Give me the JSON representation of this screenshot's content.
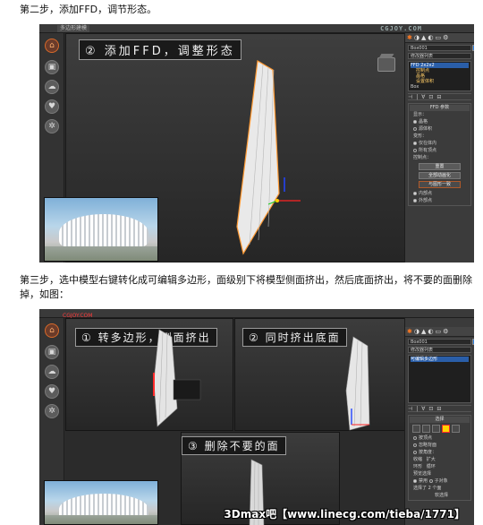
{
  "step2": {
    "text": "第二步，添加FFD，调节形态。"
  },
  "step3": {
    "text": "第三步，选中模型右键转化成可编辑多边形，面级别下将模型侧面挤出，然后底面挤出，将不要的面删除掉，如图："
  },
  "shot1": {
    "tab": "多边形建模",
    "brand": "CGJOY.COM",
    "callout": "② 添加FFD，调整形态",
    "object_name": "Box001",
    "modifier_list": "修改器列表",
    "stack": [
      "FFD 2x2x2",
      "控制点",
      "晶格",
      "设置体积",
      "Box"
    ],
    "rollout_title": "FFD 参数",
    "display_label": "显示：",
    "display_opts": [
      "晶格",
      "源体积"
    ],
    "deform_label": "变形：",
    "deform_opts": [
      "仅在体内",
      "所有顶点"
    ],
    "control_label": "控制点：",
    "buttons": [
      "重置",
      "全部动画化",
      "与图形一致"
    ],
    "checks": [
      "内部点",
      "外部点"
    ]
  },
  "shot2": {
    "tab_red": "CGJOY.COM",
    "callout1": "① 转多边形，侧面挤出",
    "callout2": "② 同时挤出底面",
    "callout3": "③ 删除不要的面",
    "object_name": "Box001",
    "modifier_list": "修改器列表",
    "stack": [
      "可编辑多边形"
    ],
    "rollout_title": "选择",
    "opts": [
      "按顶点",
      "忽略背面",
      "按角度：",
      "收缩",
      "扩大",
      "环形",
      "循环"
    ],
    "preview_label": "预览选择",
    "preview_opts": [
      "禁用",
      "子对象",
      "多个"
    ],
    "selected_count": "选择了 2 个面",
    "soft_select": "软选择"
  },
  "watermark": "3Dmax吧【www.linecg.com/tieba/1771】",
  "icons": {
    "left_toolbar": [
      "home-icon",
      "box-icon",
      "cloud-icon",
      "heart-icon",
      "gear-icon"
    ]
  }
}
